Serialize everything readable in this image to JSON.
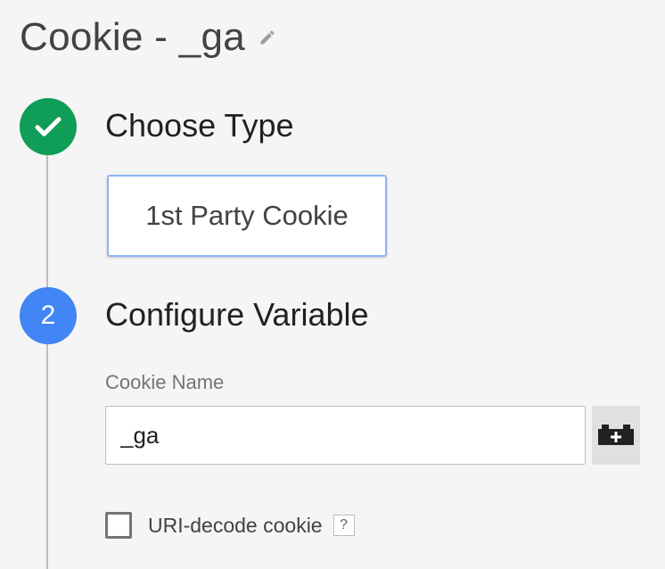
{
  "header": {
    "title": "Cookie - _ga",
    "edit_icon": "pencil-icon"
  },
  "steps": [
    {
      "status": "complete",
      "icon": "checkmark-icon",
      "color": "#0f9d58",
      "heading": "Choose Type",
      "selected_type": "1st Party Cookie"
    },
    {
      "status": "active",
      "number": "2",
      "color": "#4285f4",
      "heading": "Configure Variable",
      "cookie_name_label": "Cookie Name",
      "cookie_name_value": "_ga",
      "variable_button_icon": "add-variable-icon",
      "uri_decode_label": "URI-decode cookie",
      "uri_decode_checked": false,
      "help_glyph": "?"
    }
  ]
}
